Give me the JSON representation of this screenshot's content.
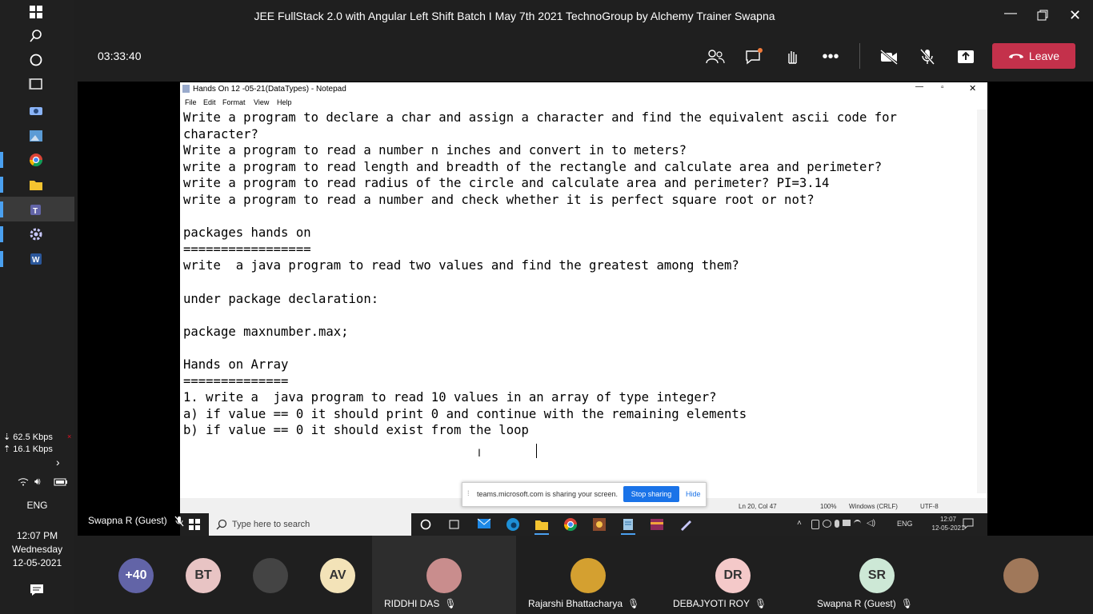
{
  "window": {
    "title": "JEE FullStack 2.0 with Angular Left Shift Batch I May 7th 2021 TechnoGroup by Alchemy Trainer Swapna"
  },
  "meeting": {
    "timer": "03:33:40",
    "leave_label": "Leave",
    "presenter_label": "Swapna R (Guest)"
  },
  "leftbar": {
    "network_down": "62.5 Kbps",
    "network_up": "16.1 Kbps",
    "language": "ENG",
    "time": "12:07 PM",
    "day": "Wednesday",
    "date": "12-05-2021"
  },
  "notepad": {
    "title": "Hands On 12 -05-21(DataTypes) - Notepad",
    "menu": [
      "File",
      "Edit",
      "Format",
      "View",
      "Help"
    ],
    "lines": [
      "Write a program to declare a char and assign a character and find the equivalent ascii code for",
      "character?",
      "Write a program to read a number n inches and convert in to meters?",
      "write a program to read length and breadth of the rectangle and calculate area and perimeter?",
      "write a program to read radius of the circle and calculate area and perimeter? PI=3.14",
      "write a program to read a number and check whether it is perfect square root or not?",
      "",
      "packages hands on",
      "=================",
      "write  a java program to read two values and find the greatest among them?",
      "",
      "under package declaration:",
      "",
      "package maxnumber.max;",
      "",
      "Hands on Array",
      "==============",
      "1. write a  java program to read 10 values in an array of type integer?",
      "a) if value == 0 it should print 0 and continue with the remaining elements",
      "b) if value == 0 it should exist from the loop"
    ],
    "status_position": "Ln 20, Col 47",
    "status_zoom": "100%",
    "status_eol": "Windows (CRLF)",
    "status_encoding": "UTF-8"
  },
  "share_banner": {
    "text": "teams.microsoft.com is sharing your screen.",
    "stop_label": "Stop sharing",
    "hide_label": "Hide"
  },
  "remote_taskbar": {
    "search_placeholder": "Type here to search",
    "language": "ENG",
    "time": "12:07",
    "date": "12-05-2021"
  },
  "participants": [
    {
      "initials": "+40",
      "name": "",
      "color": "#6264a7",
      "text_color": "#ffffff"
    },
    {
      "initials": "BT",
      "name": "",
      "color": "#e8c4c4",
      "text_color": "#333333"
    },
    {
      "initials": "",
      "name": "",
      "color": "#444444",
      "text_color": "#ffffff",
      "photo": true
    },
    {
      "initials": "AV",
      "name": "",
      "color": "#f3e3b8",
      "text_color": "#333333"
    },
    {
      "initials": "",
      "name": "RIDDHI DAS",
      "color": "#c98d8d",
      "text_color": "#ffffff",
      "photo": true
    },
    {
      "initials": "",
      "name": "Rajarshi Bhattacharya",
      "color": "#d4a030",
      "text_color": "#ffffff",
      "photo": true
    },
    {
      "initials": "DR",
      "name": "DEBAJYOTI ROY",
      "color": "#f4c9c9",
      "text_color": "#333333"
    },
    {
      "initials": "SR",
      "name": "Swapna R (Guest)",
      "color": "#cde8d6",
      "text_color": "#333333"
    },
    {
      "initials": "",
      "name": "",
      "color": "#a0785a",
      "text_color": "#ffffff",
      "photo": true
    }
  ],
  "colors": {
    "leave_red": "#c4314b",
    "teams_purple": "#6264a7",
    "accent_blue": "#4aa0f0"
  }
}
